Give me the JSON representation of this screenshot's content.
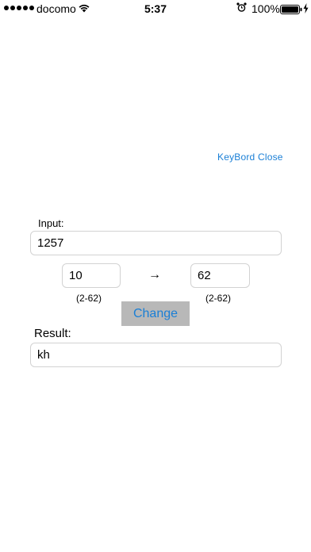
{
  "status_bar": {
    "carrier": "docomo",
    "time": "5:37",
    "battery_percent": "100%",
    "signal_bars": 5,
    "icons": [
      "signal-dots-icon",
      "wifi-icon",
      "alarm-icon",
      "battery-icon",
      "charging-icon"
    ]
  },
  "keyboard_close_label": "KeyBord Close",
  "input": {
    "label": "Input:",
    "value": "1257"
  },
  "conversion": {
    "from_base": "10",
    "to_base": "62",
    "arrow": "→",
    "from_range": "(2-62)",
    "to_range": "(2-62)"
  },
  "change_button_label": "Change",
  "result": {
    "label": "Result:",
    "value": "kh"
  },
  "colors": {
    "accent": "#1a7fd6",
    "button_bg": "#b8b8b8",
    "field_border": "#d2d2d2"
  }
}
